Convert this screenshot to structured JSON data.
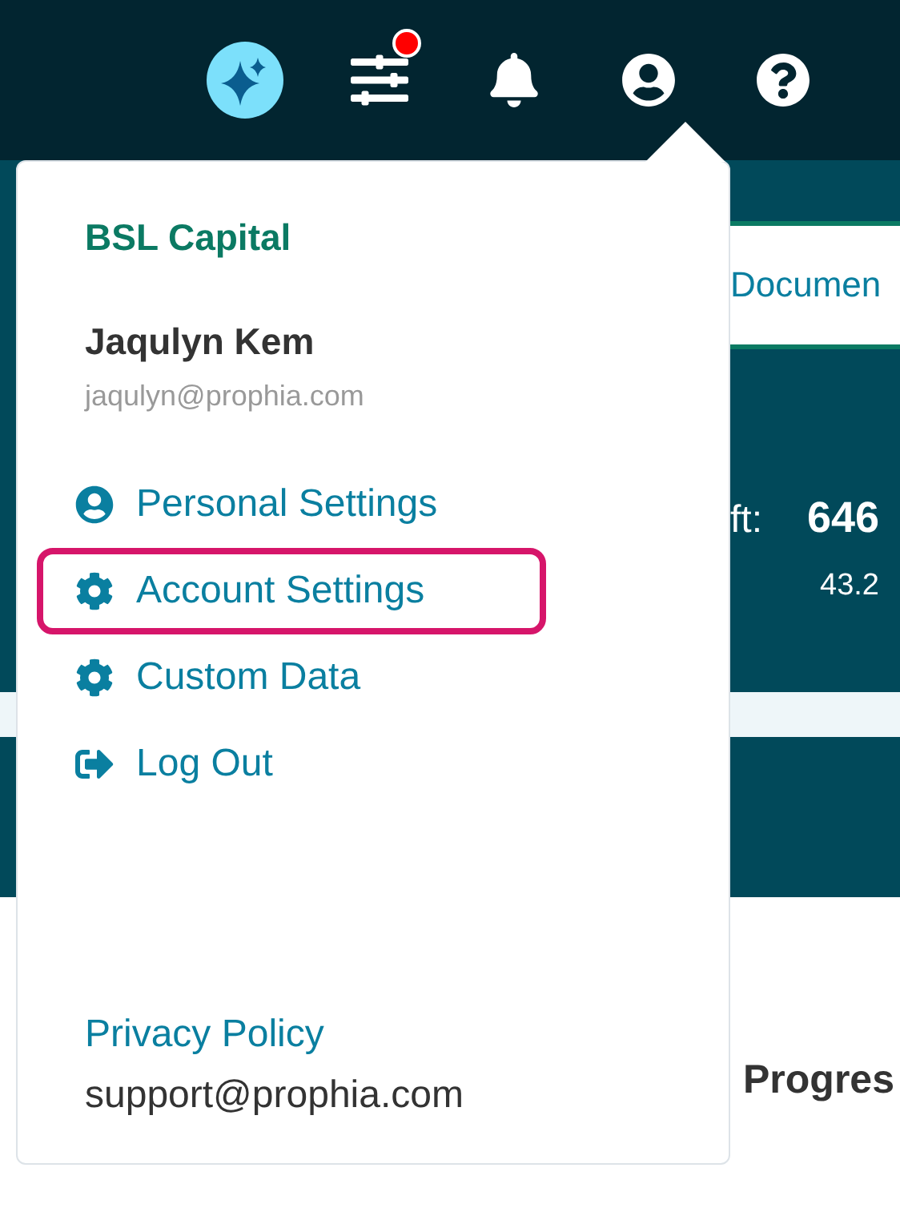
{
  "top_bar": {
    "icons": [
      {
        "kind": "assistant"
      },
      {
        "kind": "filters",
        "alert": true
      },
      {
        "kind": "notifications"
      },
      {
        "kind": "account",
        "selected": true
      },
      {
        "kind": "help"
      }
    ]
  },
  "background": {
    "tab": "Documen",
    "stat_label": "ft:",
    "stat_value": "646",
    "stat_sub": "43.2",
    "section_title": "Progres"
  },
  "account_menu": {
    "organization": "BSL Capital",
    "user_name": "Jaqulyn Kem",
    "user_email": "jaqulyn@prophia.com",
    "items": [
      {
        "kind": "user",
        "label": "Personal Settings",
        "selected": false
      },
      {
        "kind": "gear",
        "label": "Account Settings",
        "selected": true
      },
      {
        "kind": "gear",
        "label": "Custom Data",
        "selected": false
      },
      {
        "kind": "logout",
        "label": "Log Out",
        "selected": false
      }
    ],
    "privacy_link": "Privacy Policy",
    "support_email": "support@prophia.com"
  }
}
